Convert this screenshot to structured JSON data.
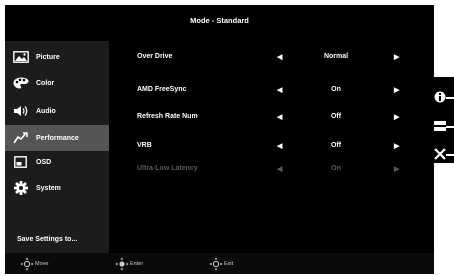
{
  "title": "Mode - Standard",
  "sidebar": {
    "items": [
      {
        "label": "Picture",
        "icon": "picture-icon"
      },
      {
        "label": "Color",
        "icon": "palette-icon"
      },
      {
        "label": "Audio",
        "icon": "speaker-icon"
      },
      {
        "label": "Performance",
        "icon": "performance-icon"
      },
      {
        "label": "OSD",
        "icon": "osd-icon"
      },
      {
        "label": "System",
        "icon": "gear-icon"
      }
    ],
    "active": "Performance",
    "save_label": "Save Settings to..."
  },
  "settings": [
    {
      "name": "Over Drive",
      "value": "Normal",
      "enabled": true
    },
    {
      "name": "AMD FreeSync",
      "value": "On",
      "enabled": true
    },
    {
      "name": "Refresh Rate Num",
      "value": "Off",
      "enabled": true
    },
    {
      "name": "VRB",
      "value": "Off",
      "enabled": true
    },
    {
      "name": "Ultra-Low Latency",
      "value": "On",
      "enabled": false
    }
  ],
  "footer": {
    "move": "Move",
    "enter": "Enter",
    "exit": "Exit"
  },
  "hotkeys": [
    "info-icon",
    "menu-icon",
    "close-icon"
  ],
  "colors": {
    "background": "#000000",
    "sidebar": "#1c1c1c",
    "active": "#555555",
    "disabled": "#5a5a5a"
  }
}
